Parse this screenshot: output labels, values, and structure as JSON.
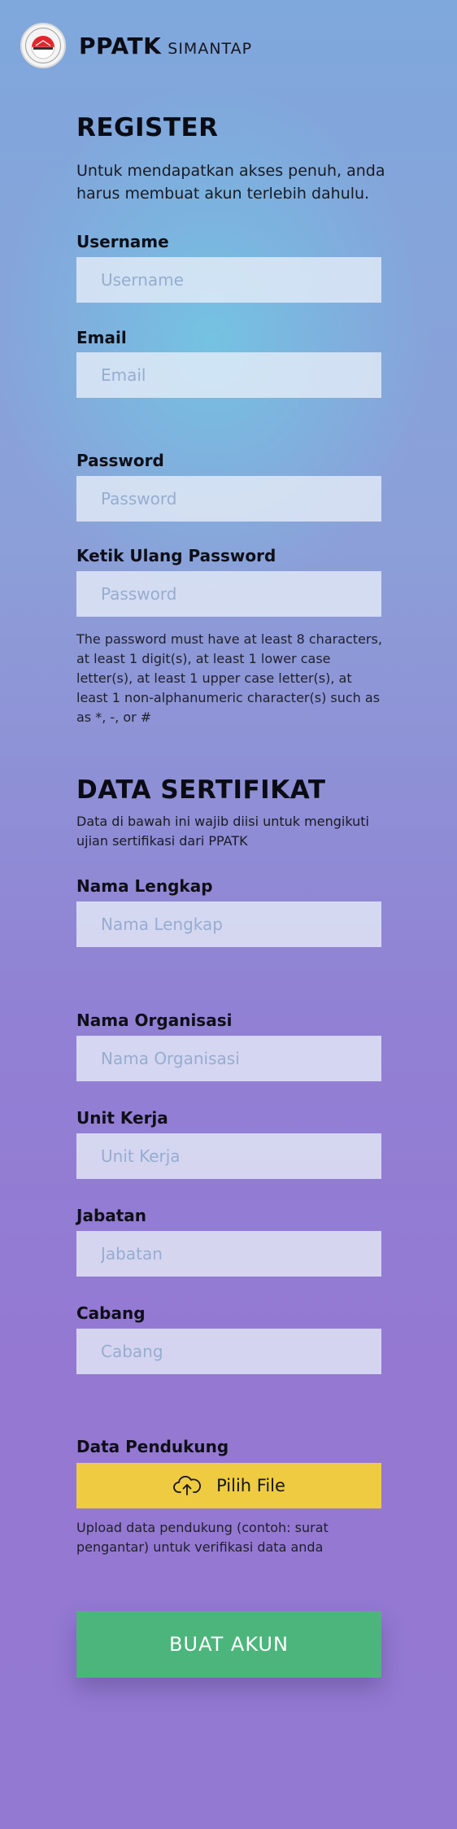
{
  "header": {
    "logo_icon": "ppatk-emblem-icon",
    "brand_main": "PPATK",
    "brand_sub": "SIMANTAP"
  },
  "register": {
    "title": "REGISTER",
    "intro": "Untuk mendapatkan akses penuh, anda harus membuat akun terlebih dahulu.",
    "username_label": "Username",
    "username_placeholder": "Username",
    "email_label": "Email",
    "email_placeholder": "Email",
    "password_label": "Password",
    "password_placeholder": "Password",
    "retype_label": "Ketik Ulang Password",
    "retype_placeholder": "Password",
    "password_hint": "The password must have at least 8 characters, at least 1 digit(s), at least 1 lower case letter(s), at least 1 upper case letter(s), at least 1 non-alphanumeric character(s) such as as *, -, or #"
  },
  "certificate": {
    "title": "DATA SERTIFIKAT",
    "intro": "Data di bawah ini wajib diisi untuk mengikuti ujian sertifikasi dari PPATK",
    "fullname_label": "Nama Lengkap",
    "fullname_placeholder": "Nama Lengkap",
    "org_label": "Nama Organisasi",
    "org_placeholder": "Nama Organisasi",
    "unit_label": "Unit Kerja",
    "unit_placeholder": "Unit Kerja",
    "position_label": "Jabatan",
    "position_placeholder": "Jabatan",
    "branch_label": "Cabang",
    "branch_placeholder": "Cabang",
    "support_label": "Data Pendukung",
    "file_button_label": "Pilih File",
    "file_icon": "cloud-upload-icon",
    "support_hint": "Upload data pendukung (contoh: surat pengantar) untuk verifikasi data anda"
  },
  "submit_label": "BUAT AKUN",
  "colors": {
    "file_button": "#eecb41",
    "submit_button": "#4cb57b",
    "placeholder": "#96add0"
  }
}
